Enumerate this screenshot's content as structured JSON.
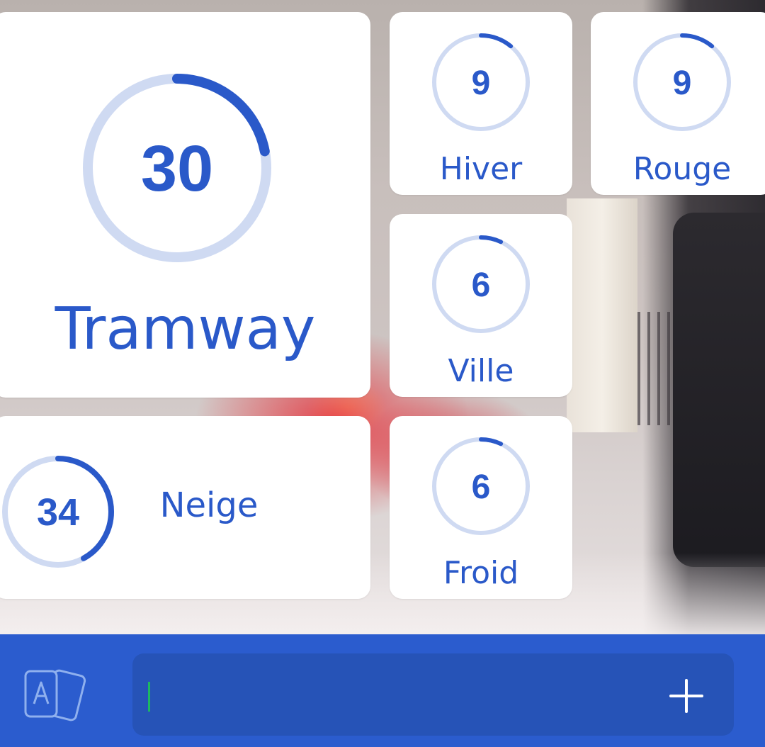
{
  "words": {
    "tramway": {
      "label": "Tramway",
      "count": "30",
      "progress": 0.22
    },
    "hiver": {
      "label": "Hiver",
      "count": "9",
      "progress": 0.11
    },
    "rouge": {
      "label": "Rouge",
      "count": "9",
      "progress": 0.11
    },
    "ville": {
      "label": "Ville",
      "count": "6",
      "progress": 0.07
    },
    "froid": {
      "label": "Froid",
      "count": "6",
      "progress": 0.07
    },
    "neige": {
      "label": "Neige",
      "count": "34",
      "progress": 0.42
    }
  },
  "input": {
    "value": "",
    "placeholder": ""
  },
  "icons": {
    "cards": "cards-icon",
    "add": "plus-icon"
  },
  "colors": {
    "accent": "#2a59c9",
    "ring_track": "#cfdaf2",
    "bar": "#2b5cce",
    "input_bg": "#2653b7",
    "caret": "#1db860"
  }
}
